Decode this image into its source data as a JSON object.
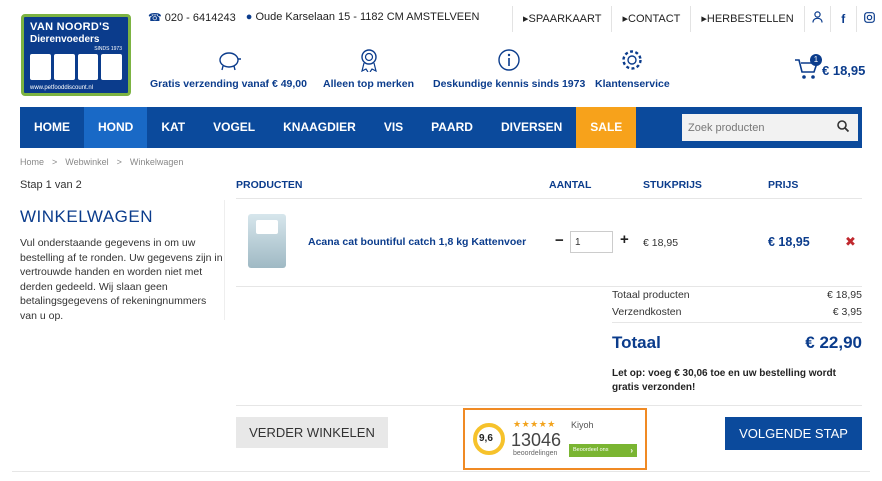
{
  "contact": {
    "phone": "020 - 6414243",
    "address": "Oude Karselaan 15 - 1182 CM AMSTELVEEN"
  },
  "toplinks": [
    "SPAARKAART",
    "CONTACT",
    "HERBESTELLEN"
  ],
  "logo": {
    "line1": "VAN NOORD'S",
    "line2": "Dierenvoeders",
    "since": "SINDS 1973",
    "url": "www.petfooddiscount.nl"
  },
  "usps": [
    {
      "icon": "piggy-bank-icon",
      "label": "Gratis verzending vanaf € 49,00"
    },
    {
      "icon": "award-icon",
      "label": "Alleen top merken"
    },
    {
      "icon": "info-icon",
      "label": "Deskundige kennis sinds 1973"
    },
    {
      "icon": "gear-icon",
      "label": "Klantenservice"
    }
  ],
  "cart": {
    "count": "1",
    "total": "€ 18,95"
  },
  "nav": [
    "HOME",
    "HOND",
    "KAT",
    "VOGEL",
    "KNAAGDIER",
    "VIS",
    "PAARD",
    "DIVERSEN",
    "SALE"
  ],
  "nav_active": "HOND",
  "search": {
    "placeholder": "Zoek producten"
  },
  "breadcrumb": [
    "Home",
    ">",
    "Webwinkel",
    ">",
    "Winkelwagen"
  ],
  "step": "Stap 1 van 2",
  "title": "WINKELWAGEN",
  "intro": "Vul onderstaande gegevens in om uw bestelling af te ronden. Uw gegevens zijn in vertrouwde handen en worden niet met derden gedeeld. Wij slaan geen betalingsgegevens of rekeningnummers van u op.",
  "table": {
    "headers": {
      "products": "PRODUCTEN",
      "quantity": "AANTAL",
      "unit_price": "STUKPRIJS",
      "price": "PRIJS"
    },
    "item": {
      "name": "Acana cat bountiful catch 1,8 kg Kattenvoer",
      "quantity": "1",
      "unit_price": "€ 18,95",
      "price": "€ 18,95"
    }
  },
  "summary": {
    "products_label": "Totaal producten",
    "products_value": "€ 18,95",
    "shipping_label": "Verzendkosten",
    "shipping_value": "€ 3,95",
    "total_label": "Totaal",
    "total_value": "€ 22,90",
    "note": "Let op: voeg € 30,06 toe en uw bestelling wordt gratis verzonden!"
  },
  "buttons": {
    "continue": "VERDER WINKELEN",
    "next": "VOLGENDE STAP"
  },
  "kiyoh": {
    "score": "9,6",
    "stars": "★★★★★",
    "brand": "Kiyoh",
    "count": "13046",
    "label": "beoordelingen",
    "rate": "Beoordeel ons"
  },
  "colors": {
    "brand_blue": "#0b4a9c",
    "sale_orange": "#f7a21b",
    "kiyoh_border": "#f08a24",
    "delete_red": "#c0282e"
  }
}
